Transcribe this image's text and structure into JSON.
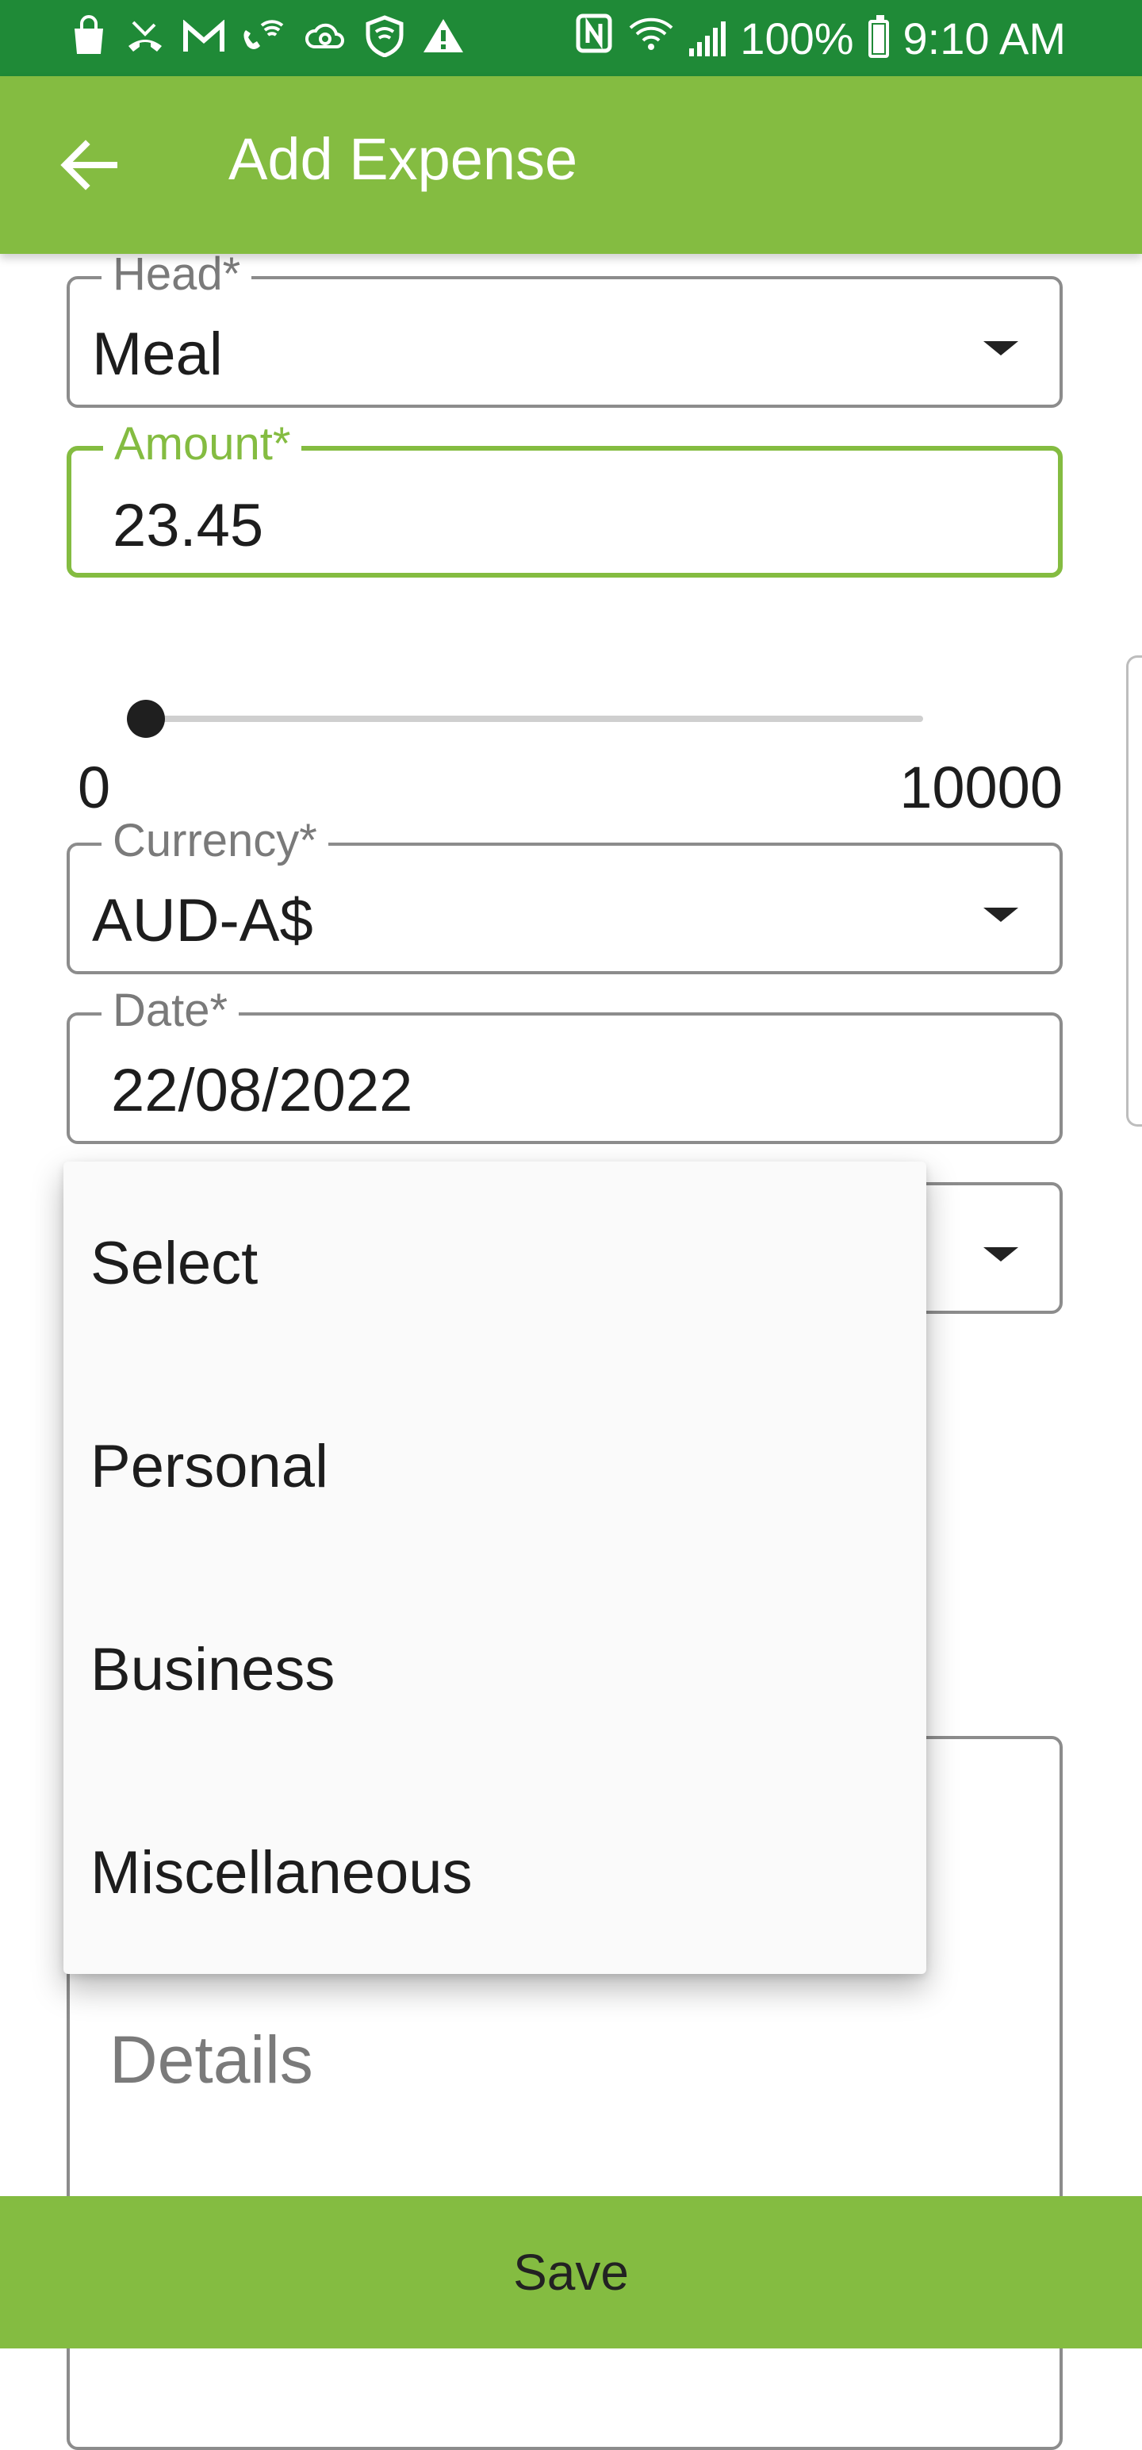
{
  "status_bar": {
    "left_icons": [
      "shopping-bag-icon",
      "missed-call-icon",
      "gmail-icon",
      "wifi-call-icon",
      "cloud-sync-icon",
      "shield-icon",
      "warning-icon"
    ],
    "battery_text": "100%",
    "time": "9:10 AM"
  },
  "appbar": {
    "title": "Add Expense",
    "back_icon": "arrow-back-icon"
  },
  "form": {
    "head": {
      "label": "Head*",
      "value": "Meal"
    },
    "amount": {
      "label": "Amount*",
      "value": "23.45"
    },
    "slider": {
      "min_label": "0",
      "max_label": "10000",
      "value": 23.45
    },
    "currency": {
      "label": "Currency*",
      "value": "AUD-A$"
    },
    "date": {
      "label": "Date*",
      "value": "22/08/2022"
    },
    "details": {
      "placeholder": "Details"
    }
  },
  "dropdown": {
    "options": [
      "Select",
      "Personal",
      "Business",
      "Miscellaneous"
    ]
  },
  "footer": {
    "save_label": "Save"
  },
  "colors": {
    "status_bar": "#1f8a37",
    "accent": "#84bc41",
    "border": "#8c8c8c"
  }
}
